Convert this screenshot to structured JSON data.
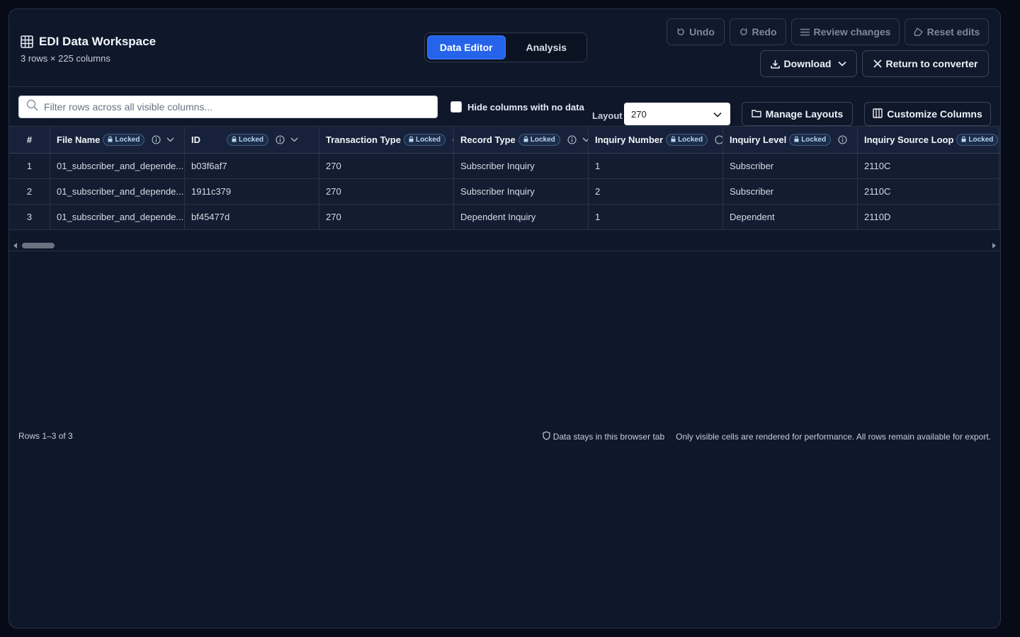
{
  "header": {
    "title": "EDI Data Workspace",
    "subtitle": "3 rows × 225 columns",
    "tabs": [
      {
        "label": "Data Editor",
        "active": true
      },
      {
        "label": "Analysis",
        "active": false
      }
    ],
    "buttons": {
      "undo": "Undo",
      "redo": "Redo",
      "review": "Review changes",
      "reset": "Reset edits",
      "download": "Download",
      "return": "Return to converter"
    }
  },
  "toolbar": {
    "search_placeholder": "Filter rows across all visible columns...",
    "hide_empty_label": "Hide columns with no data",
    "hide_empty_checked": false,
    "layout_label": "Layout",
    "layout_value": "270",
    "manage_layouts": "Manage Layouts",
    "customize_columns": "Customize Columns"
  },
  "table": {
    "index_header": "#",
    "locked_label": "Locked",
    "columns": [
      {
        "name": "File Name"
      },
      {
        "name": "ID"
      },
      {
        "name": "Transaction Type"
      },
      {
        "name": "Record Type"
      },
      {
        "name": "Inquiry Number"
      },
      {
        "name": "Inquiry Level"
      },
      {
        "name": "Inquiry Source Loop"
      }
    ],
    "rows": [
      {
        "index": "1",
        "cells": [
          "01_subscriber_and_depende...",
          "b03f6af7",
          "270",
          "Subscriber Inquiry",
          "1",
          "Subscriber",
          "2110C"
        ]
      },
      {
        "index": "2",
        "cells": [
          "01_subscriber_and_depende...",
          "1911c379",
          "270",
          "Subscriber Inquiry",
          "2",
          "Subscriber",
          "2110C"
        ]
      },
      {
        "index": "3",
        "cells": [
          "01_subscriber_and_depende...",
          "bf45477d",
          "270",
          "Dependent Inquiry",
          "1",
          "Dependent",
          "2110D"
        ]
      }
    ]
  },
  "footer": {
    "rows_info": "Rows 1–3 of 3",
    "privacy": "Data stays in this browser tab",
    "performance": "Only visible cells are rendered for performance. All rows remain available for export."
  },
  "colors": {
    "accent": "#2563eb",
    "panel": "#0f172a",
    "locked_badge": "#1b2d48"
  },
  "icons": {
    "title": "grid-icon",
    "undo": "rotate-ccw-icon",
    "redo": "rotate-cw-icon",
    "review": "list-icon",
    "reset": "eraser-icon",
    "download": "download-icon",
    "return": "close-icon",
    "search": "search-icon",
    "manage": "folder-icon",
    "customize": "columns-icon",
    "locked": "lock-icon",
    "info": "info-icon",
    "sort": "chevron-down-icon",
    "privacy": "shield-icon"
  }
}
